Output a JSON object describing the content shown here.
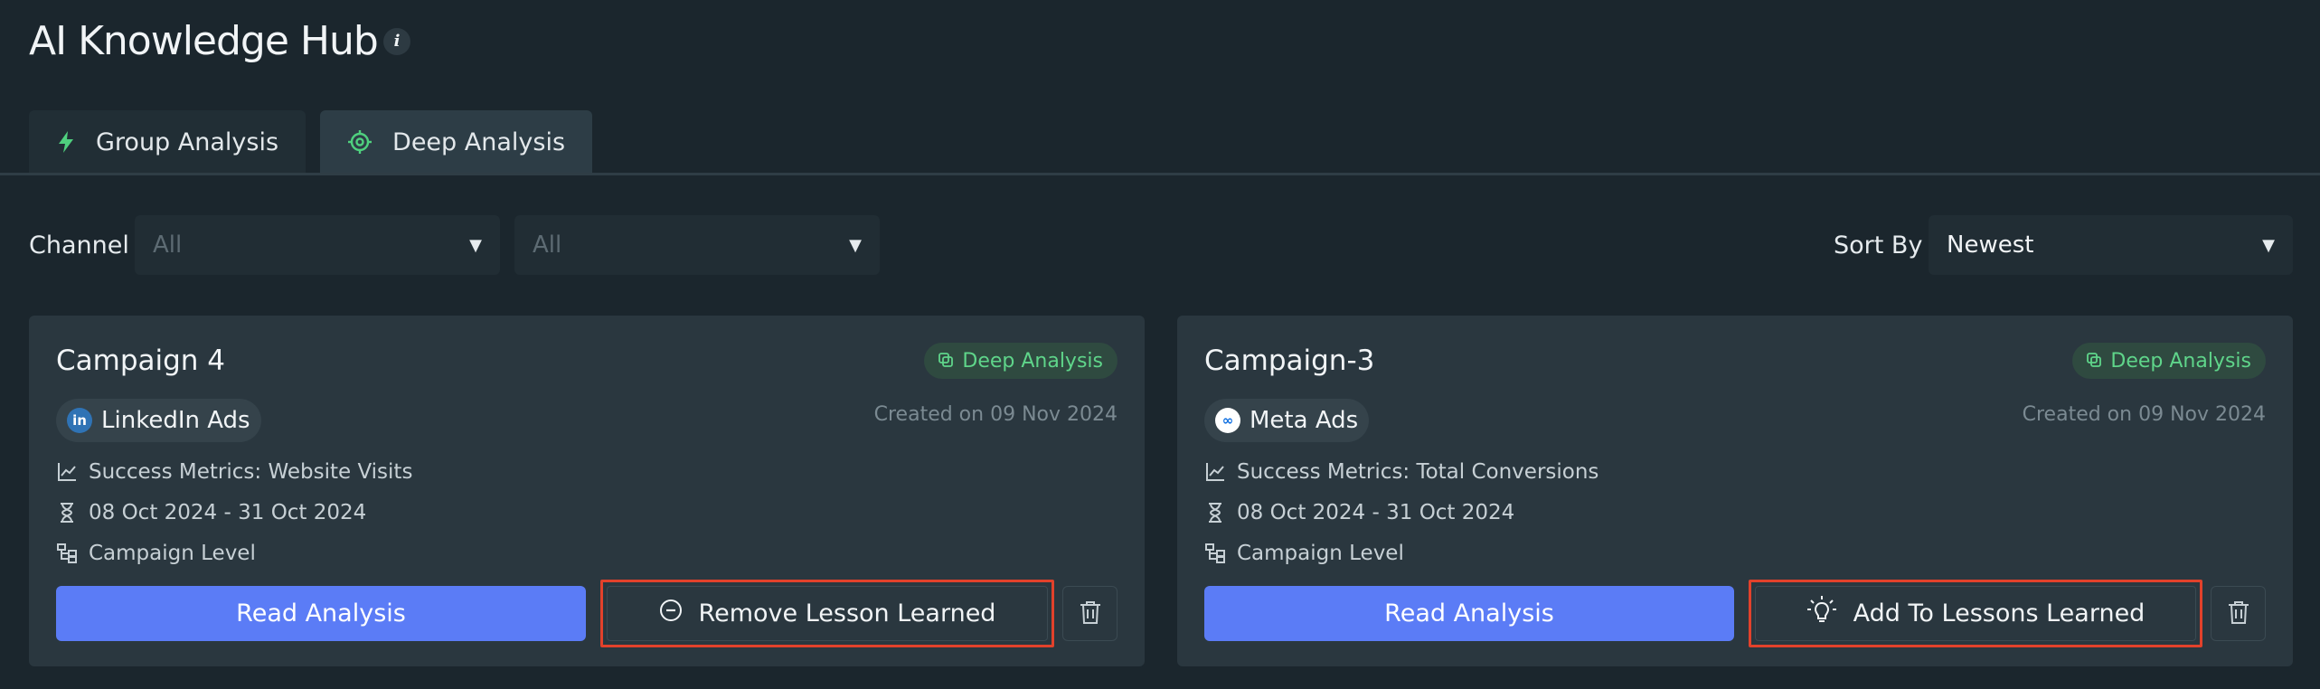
{
  "header": {
    "title": "AI Knowledge Hub",
    "info_icon": "i"
  },
  "tabs": [
    {
      "label": "Group Analysis",
      "icon": "lightning-icon",
      "active": false
    },
    {
      "label": "Deep Analysis",
      "icon": "target-icon",
      "active": true
    }
  ],
  "filters": {
    "channel_label": "Channel",
    "channel_value": "All",
    "secondary_value": "All",
    "sort_label": "Sort By",
    "sort_value": "Newest"
  },
  "colors": {
    "background": "#1b262d",
    "card": "#2a373f",
    "accent_button": "#5b7cf6",
    "badge_text": "#5fd58a",
    "highlight_border": "#e2412b"
  },
  "cards": [
    {
      "title": "Campaign 4",
      "badge": "Deep Analysis",
      "channel": "LinkedIn Ads",
      "channel_icon_text": "in",
      "created": "Created on 09 Nov 2024",
      "success_metrics": "Success Metrics: Website Visits",
      "date_range": "08 Oct 2024 - 31 Oct 2024",
      "level": "Campaign Level",
      "read_label": "Read Analysis",
      "lesson_label": "Remove Lesson Learned"
    },
    {
      "title": "Campaign-3",
      "badge": "Deep Analysis",
      "channel": "Meta Ads",
      "channel_icon_text": "∞",
      "created": "Created on 09 Nov 2024",
      "success_metrics": "Success Metrics: Total Conversions",
      "date_range": "08 Oct 2024 - 31 Oct 2024",
      "level": "Campaign Level",
      "read_label": "Read Analysis",
      "lesson_label": "Add To Lessons Learned"
    }
  ]
}
